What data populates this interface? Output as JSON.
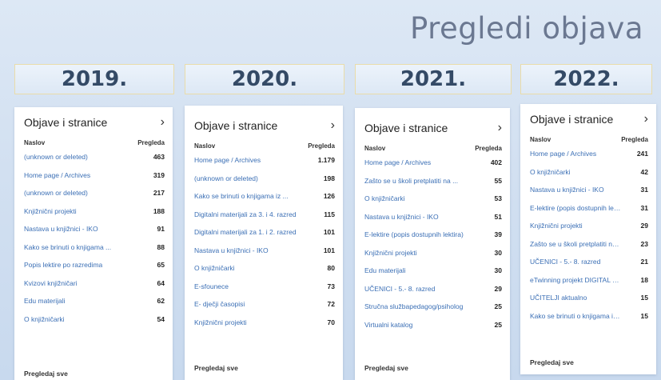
{
  "title": "Pregledi objava",
  "table_header": {
    "col_name": "Naslov",
    "col_views": "Pregleda"
  },
  "card_title": "Objave i stranice",
  "see_all_label": "Pregledaj sve",
  "columns": [
    {
      "year": "2019.",
      "rows": [
        {
          "label": "(unknown or deleted)",
          "views": "463"
        },
        {
          "label": "Home page / Archives",
          "views": "319"
        },
        {
          "label": "(unknown or deleted)",
          "views": "217"
        },
        {
          "label": "Knjižnični projekti",
          "views": "188"
        },
        {
          "label": "Nastava u knjižnici - IKO",
          "views": "91"
        },
        {
          "label": "Kako se brinuti o knjigama ...",
          "views": "88"
        },
        {
          "label": "Popis lektire po razredima",
          "views": "65"
        },
        {
          "label": "Kvizovi knjižničari",
          "views": "64"
        },
        {
          "label": "Edu materijali",
          "views": "62"
        },
        {
          "label": "O knjižničarki",
          "views": "54"
        }
      ]
    },
    {
      "year": "2020.",
      "rows": [
        {
          "label": "Home page / Archives",
          "views": "1.179"
        },
        {
          "label": "(unknown or deleted)",
          "views": "198"
        },
        {
          "label": "Kako se brinuti o knjigama iz ...",
          "views": "126"
        },
        {
          "label": "Digitalni materijali za 3. i 4. razred",
          "views": "115"
        },
        {
          "label": "Digitalni materijali za 1. i 2. razred",
          "views": "101"
        },
        {
          "label": "Nastava u knjižnici - IKO",
          "views": "101"
        },
        {
          "label": "O knjižničarki",
          "views": "80"
        },
        {
          "label": "E-sfounece",
          "views": "73"
        },
        {
          "label": "E- dječji časopisi",
          "views": "72"
        },
        {
          "label": "Knjižnični projekti",
          "views": "70"
        }
      ]
    },
    {
      "year": "2021.",
      "rows": [
        {
          "label": "Home page / Archives",
          "views": "402"
        },
        {
          "label": "Zašto se u školi pretplatiti na ...",
          "views": "55"
        },
        {
          "label": "O knjižničarki",
          "views": "53"
        },
        {
          "label": "Nastava u knjižnici - IKO",
          "views": "51"
        },
        {
          "label": "E-lektire (popis dostupnih lektira)",
          "views": "39"
        },
        {
          "label": "Knjižnični projekti",
          "views": "30"
        },
        {
          "label": "Edu materijali",
          "views": "30"
        },
        {
          "label": "UČENICI - 5.- 8. razred",
          "views": "29"
        },
        {
          "label": "Stručna službapedagog/psiholog",
          "views": "25"
        },
        {
          "label": "Virtualni katalog",
          "views": "25"
        }
      ]
    },
    {
      "year": "2022.",
      "rows": [
        {
          "label": "Home page / Archives",
          "views": "241"
        },
        {
          "label": "O knjižničarki",
          "views": "42"
        },
        {
          "label": "Nastava u knjižnici - IKO",
          "views": "31"
        },
        {
          "label": "E-lektire (popis dostupnih lektira)",
          "views": "31"
        },
        {
          "label": "Knjižnični projekti",
          "views": "29"
        },
        {
          "label": "Zašto se u školi pretplatiti na ...",
          "views": "23"
        },
        {
          "label": "UČENICI - 5.- 8. razred",
          "views": "21"
        },
        {
          "label": "eTwinning projekt DIGITAL HUB",
          "views": "18"
        },
        {
          "label": "UČITELJI aktualno",
          "views": "15"
        },
        {
          "label": "Kako se brinuti o knjigama iz ...",
          "views": "15"
        }
      ]
    }
  ]
}
